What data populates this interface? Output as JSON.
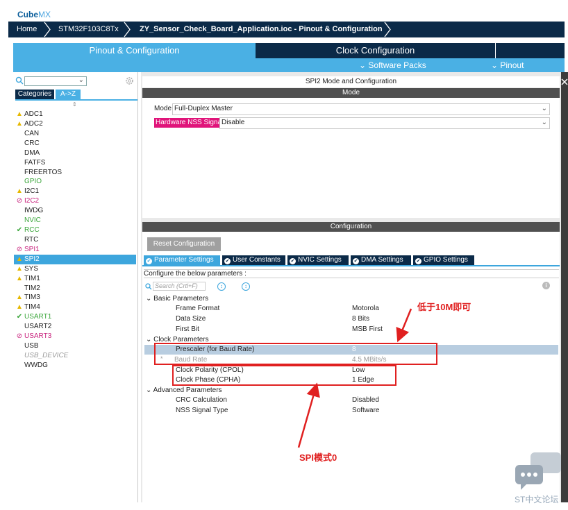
{
  "logo": {
    "part1": "Cube",
    "part2": "MX"
  },
  "breadcrumb": [
    "Home",
    "STM32F103C8Tx",
    "ZY_Sensor_Check_Board_Application.ioc - Pinout & Configuration"
  ],
  "tabs": {
    "pinout": "Pinout & Configuration",
    "clock": "Clock Configuration"
  },
  "subtabs": {
    "software_packs": "Software Packs",
    "pinout": "Pinout"
  },
  "sidebar": {
    "category_tab": "Categories",
    "az_tab": "A->Z",
    "items": [
      {
        "label": "ADC1",
        "status": "warn"
      },
      {
        "label": "ADC2",
        "status": "warn"
      },
      {
        "label": "CAN",
        "status": "none"
      },
      {
        "label": "CRC",
        "status": "none"
      },
      {
        "label": "DMA",
        "status": "none"
      },
      {
        "label": "FATFS",
        "status": "none"
      },
      {
        "label": "FREERTOS",
        "status": "none"
      },
      {
        "label": "GPIO",
        "status": "green"
      },
      {
        "label": "I2C1",
        "status": "warn"
      },
      {
        "label": "I2C2",
        "status": "blocked"
      },
      {
        "label": "IWDG",
        "status": "none"
      },
      {
        "label": "NVIC",
        "status": "green"
      },
      {
        "label": "RCC",
        "status": "ok"
      },
      {
        "label": "RTC",
        "status": "none"
      },
      {
        "label": "SPI1",
        "status": "blocked"
      },
      {
        "label": "SPI2",
        "status": "selected"
      },
      {
        "label": "SYS",
        "status": "warn"
      },
      {
        "label": "TIM1",
        "status": "warn"
      },
      {
        "label": "TIM2",
        "status": "none"
      },
      {
        "label": "TIM3",
        "status": "warn"
      },
      {
        "label": "TIM4",
        "status": "warn"
      },
      {
        "label": "USART1",
        "status": "ok"
      },
      {
        "label": "USART2",
        "status": "none"
      },
      {
        "label": "USART3",
        "status": "blocked"
      },
      {
        "label": "USB",
        "status": "none"
      },
      {
        "label": "USB_DEVICE",
        "status": "disabled"
      },
      {
        "label": "WWDG",
        "status": "none"
      }
    ]
  },
  "mode_panel": {
    "header": "SPI2 Mode and Configuration",
    "bar": "Mode",
    "mode_label": "Mode",
    "mode_value": "Full-Duplex Master",
    "nss_label": "Hardware NSS Signal",
    "nss_value": "Disable"
  },
  "config_panel": {
    "bar": "Configuration",
    "reset_button": "Reset Configuration",
    "tabs": [
      "Parameter Settings",
      "User Constants",
      "NVIC Settings",
      "DMA Settings",
      "GPIO Settings"
    ],
    "configure_text": "Configure the below parameters :",
    "search_placeholder": "Search (Crtl+F)",
    "groups": {
      "basic": "Basic Parameters",
      "clock": "Clock Parameters",
      "advanced": "Advanced Parameters"
    },
    "params": [
      {
        "name": "Frame Format",
        "value": "Motorola"
      },
      {
        "name": "Data Size",
        "value": "8 Bits"
      },
      {
        "name": "First Bit",
        "value": "MSB First"
      },
      {
        "name": "Prescaler (for Baud Rate)",
        "value": "8"
      },
      {
        "name": "Baud Rate",
        "value": "4.5 MBits/s"
      },
      {
        "name": "Clock Polarity (CPOL)",
        "value": "Low"
      },
      {
        "name": "Clock Phase (CPHA)",
        "value": "1 Edge"
      },
      {
        "name": "CRC Calculation",
        "value": "Disabled"
      },
      {
        "name": "NSS Signal Type",
        "value": "Software"
      }
    ]
  },
  "annotations": {
    "below_10m": "低于10M即可",
    "spi_mode": "SPI模式0"
  },
  "watermark": "ST中文论坛",
  "colors": {
    "accent": "#4ab0e4",
    "dark": "#0b2a48",
    "annotation": "#e02020",
    "nss_label_bg": "#e0147a"
  }
}
